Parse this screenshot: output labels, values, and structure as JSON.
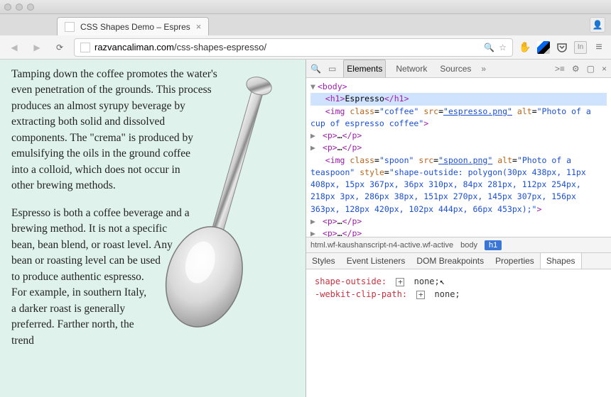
{
  "tab": {
    "title": "CSS Shapes Demo – Espres"
  },
  "url": {
    "domain": "razvancaliman.com",
    "path": "/css-shapes-espresso/"
  },
  "page": {
    "p1": "Tamping down the coffee promotes the water's even penetration of the grounds. This process produces an almost syrupy beverage by extracting both solid and dissolved components. The \"crema\" is produced by emulsifying the oils in the ground coffee into a colloid, which does not occur in other brewing methods.",
    "p2": "Espresso is both a coffee beverage and a brewing method. It is not a specific bean, bean blend, or roast level. Any bean or roasting level can be used to produce authentic espresso. For example, in southern Italy, a darker roast is generally preferred. Farther north, the trend"
  },
  "devtools": {
    "tabs": {
      "elements": "Elements",
      "network": "Network",
      "sources": "Sources"
    },
    "dom": {
      "body_open": "<body>",
      "h1_open": "<h1>",
      "h1_text": "Espresso",
      "h1_close": "</h1>",
      "img1": "<img class=\"coffee\" src=\"espresso.png\" alt=\"Photo of a cup of espresso coffee\">",
      "pline": "<p>…</p>",
      "img2": "<img class=\"spoon\" src=\"spoon.png\" alt=\"Photo of a teaspoon\" style=\"shape-outside: polygon(30px 438px, 11px 408px, 15px 367px, 36px 310px, 84px 281px, 112px 254px, 218px 3px, 286px 38px, 151px 270px, 145px 307px, 156px 363px, 128px 420px, 102px 444px, 66px 453px);\">"
    },
    "breadcrumb": {
      "root": "html.wf-kaushanscript-n4-active.wf-active",
      "body": "body",
      "h1": "h1"
    },
    "styles_tabs": {
      "styles": "Styles",
      "event": "Event Listeners",
      "dom": "DOM Breakpoints",
      "props": "Properties",
      "shapes": "Shapes"
    },
    "shapes": {
      "prop1": "shape-outside:",
      "val1": "none;",
      "prop2": "-webkit-clip-path:",
      "val2": "none;"
    }
  }
}
